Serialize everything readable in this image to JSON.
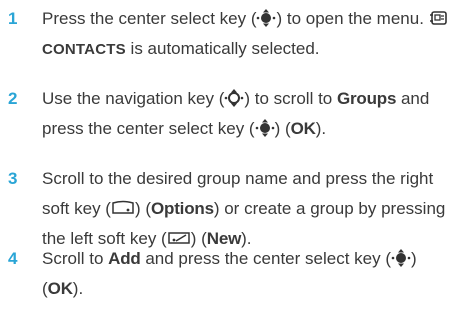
{
  "colors": {
    "step_number": "#2aa5d6",
    "text": "#3a3a3a"
  },
  "steps": [
    {
      "number": "1",
      "t1": "Press the center select key (",
      "t2": ") to open the menu.",
      "contacts": "CONTACTS",
      "t3": " is automatically selected.",
      "icons": [
        "center-select-key-icon",
        "contacts-icon"
      ]
    },
    {
      "number": "2",
      "t1": "Use the navigation key (",
      "t2": ") to scroll to ",
      "groups": "Groups",
      "t3": " and press the center select key (",
      "t4": ") (",
      "ok": "OK",
      "t5": ").",
      "icons": [
        "navigation-key-icon",
        "center-select-key-icon"
      ]
    },
    {
      "number": "3",
      "t1": "Scroll to the desired group name and press the right soft key (",
      "t2": ") (",
      "options": "Options",
      "t3": ") or create a group by pressing the left soft key (",
      "t4": ") (",
      "new": "New",
      "t5": ").",
      "icons": [
        "right-soft-key-icon",
        "left-soft-key-icon"
      ]
    },
    {
      "number": "4",
      "t1": "Scroll to ",
      "add": "Add",
      "t2": " and press the center select key (",
      "t3": ") (",
      "ok": "OK",
      "t4": ").",
      "icons": [
        "center-select-key-icon"
      ]
    }
  ]
}
